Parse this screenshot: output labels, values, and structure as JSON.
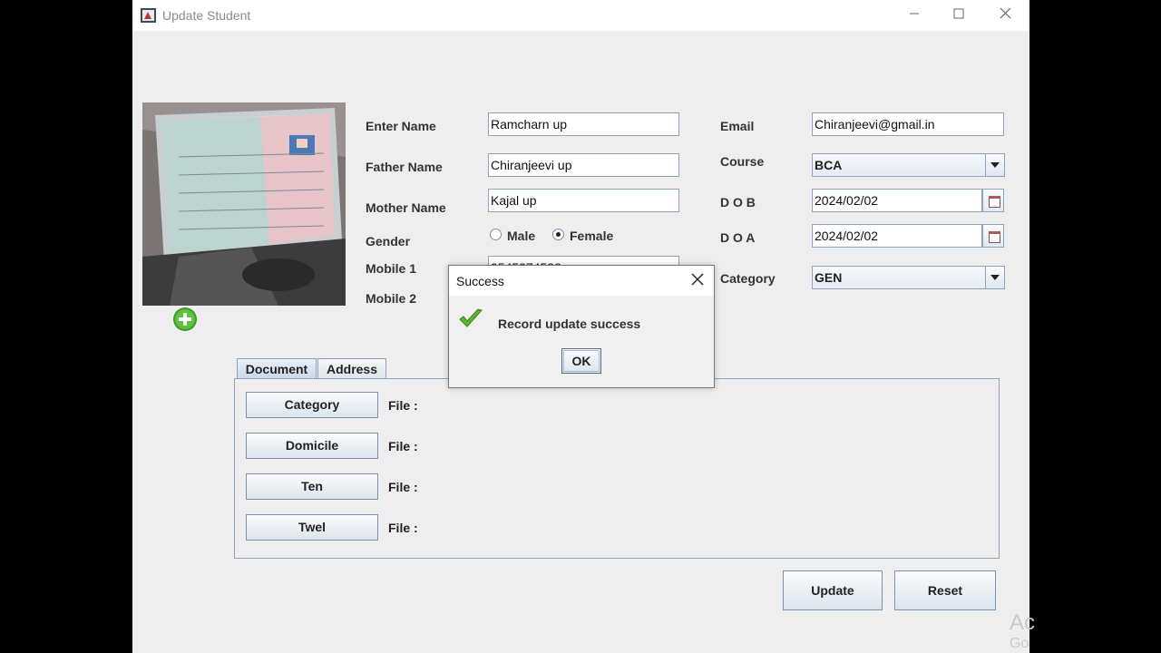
{
  "window": {
    "title": "Update Student"
  },
  "form": {
    "labels": {
      "name": "Enter Name",
      "father": "Father Name",
      "mother": "Mother Name",
      "gender": "Gender",
      "mobile1": "Mobile 1",
      "mobile2": "Mobile 2",
      "email": "Email",
      "course": "Course",
      "dob": "D O B",
      "doa": "D O A",
      "category": "Category"
    },
    "values": {
      "name": "Ramcharn up",
      "father": "Chiranjeevi up",
      "mother": "Kajal up",
      "mobile1": "9545874588",
      "email": "Chiranjeevi@gmail.in",
      "course": "BCA",
      "dob": "2024/02/02",
      "doa": "2024/02/02",
      "category": "GEN"
    },
    "gender_options": {
      "male": "Male",
      "female": "Female",
      "selected": "Female"
    }
  },
  "tabs": {
    "document": "Document",
    "address": "Address",
    "active": "Document"
  },
  "documents": [
    {
      "button": "Category",
      "file_label": "File :"
    },
    {
      "button": "Domicile",
      "file_label": "File :"
    },
    {
      "button": "Ten",
      "file_label": "File :"
    },
    {
      "button": "Twel",
      "file_label": "File :"
    }
  ],
  "actions": {
    "update": "Update",
    "reset": "Reset"
  },
  "dialog": {
    "title": "Success",
    "message": "Record update success",
    "ok": "OK"
  },
  "watermark": {
    "line1": "Ac",
    "line2": "Go"
  },
  "icons": {
    "app": "java-app-icon",
    "add_photo": "plus-circle-icon",
    "success": "checkmark-icon",
    "calendar": "calendar-icon"
  }
}
